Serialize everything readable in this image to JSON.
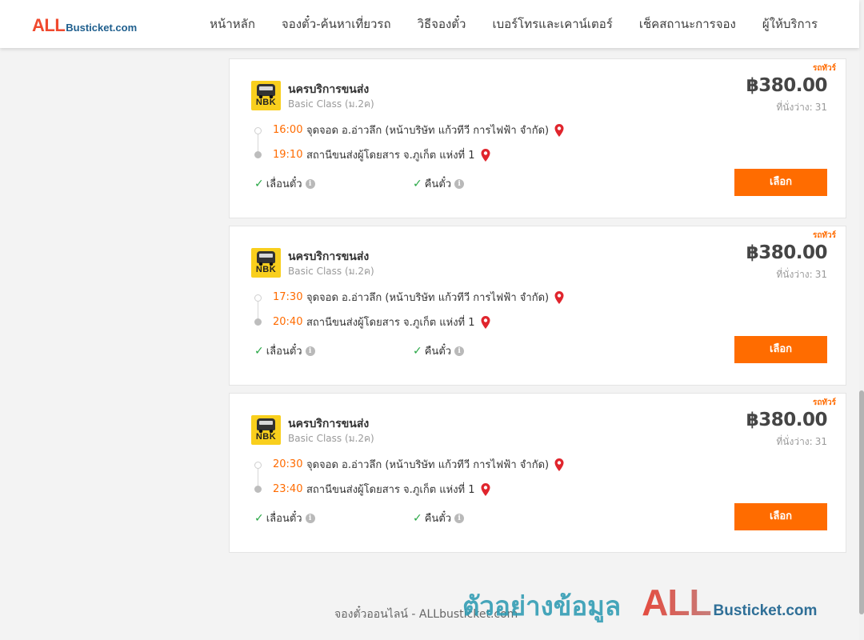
{
  "header": {
    "logo": {
      "all": "ALL",
      "rest": "Busticket.com"
    },
    "nav": [
      {
        "label": "หน้าหลัก"
      },
      {
        "label": "จองตั๋ว-ค้นหาเที่ยวรถ"
      },
      {
        "label": "วิธีจองตั๋ว"
      },
      {
        "label": "เบอร์โทรและเคาน์เตอร์"
      },
      {
        "label": "เช็คสถานะการจอง"
      },
      {
        "label": "ผู้ให้บริการ"
      }
    ]
  },
  "trips": [
    {
      "tag": "รถทัวร์",
      "operator": "นครบริการขนส่ง",
      "logo_text": "NBK",
      "bus_class": "Basic Class (ม.2ค)",
      "price": "฿380.00",
      "seats_label": "ที่นั่งว่าง:",
      "seats": "31",
      "departure": {
        "time": "16:00",
        "place": "จุดจอด อ.อ่าวลึก (หน้าบริษัท แก้วทีวี การไฟฟ้า จำกัด)"
      },
      "arrival": {
        "time": "19:10",
        "place": "สถานีขนส่งผู้โดยสาร จ.ภูเก็ต แห่งที่ 1"
      },
      "feature_1": "เลื่อนตั๋ว",
      "feature_2": "คืนตั๋ว",
      "select_label": "เลือก"
    },
    {
      "tag": "รถทัวร์",
      "operator": "นครบริการขนส่ง",
      "logo_text": "NBK",
      "bus_class": "Basic Class (ม.2ค)",
      "price": "฿380.00",
      "seats_label": "ที่นั่งว่าง:",
      "seats": "31",
      "departure": {
        "time": "17:30",
        "place": "จุดจอด อ.อ่าวลึก (หน้าบริษัท แก้วทีวี การไฟฟ้า จำกัด)"
      },
      "arrival": {
        "time": "20:40",
        "place": "สถานีขนส่งผู้โดยสาร จ.ภูเก็ต แห่งที่ 1"
      },
      "feature_1": "เลื่อนตั๋ว",
      "feature_2": "คืนตั๋ว",
      "select_label": "เลือก"
    },
    {
      "tag": "รถทัวร์",
      "operator": "นครบริการขนส่ง",
      "logo_text": "NBK",
      "bus_class": "Basic Class (ม.2ค)",
      "price": "฿380.00",
      "seats_label": "ที่นั่งว่าง:",
      "seats": "31",
      "departure": {
        "time": "20:30",
        "place": "จุดจอด อ.อ่าวลึก (หน้าบริษัท แก้วทีวี การไฟฟ้า จำกัด)"
      },
      "arrival": {
        "time": "23:40",
        "place": "สถานีขนส่งผู้โดยสาร จ.ภูเก็ต แห่งที่ 1"
      },
      "feature_1": "เลื่อนตั๋ว",
      "feature_2": "คืนตั๋ว",
      "select_label": "เลือก"
    }
  ],
  "footer": {
    "text": "จองตั๋วออนไลน์ - ALLbusticket.com"
  },
  "watermark": {
    "thai": "ตัวอย่างข้อมูล",
    "all": "ALL",
    "rest": "Busticket.com"
  },
  "colors": {
    "accent": "#ff6c00",
    "time": "#ff6b00",
    "check": "#28a745",
    "pin": "#e0252d"
  },
  "icons": {
    "check": "check-icon",
    "info": "info-icon",
    "pin": "map-pin-icon"
  }
}
